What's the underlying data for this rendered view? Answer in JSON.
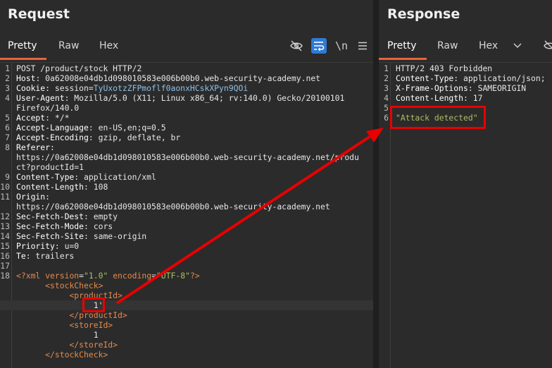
{
  "request": {
    "title": "Request",
    "tabs": [
      "Pretty",
      "Raw",
      "Hex"
    ],
    "active_tab": "Pretty",
    "toolbar": {
      "newline_label": "\\n",
      "menu_icon": "hamburger-icon",
      "hide_icon": "eye-off-icon",
      "wrap_icon": "wrap-lines-icon"
    },
    "lines": [
      {
        "n": "1",
        "parts": [
          [
            "plain",
            "POST /product/stock HTTP/2"
          ]
        ]
      },
      {
        "n": "2",
        "parts": [
          [
            "hname",
            "Host"
          ],
          [
            "plain",
            ": 0a62008e04db1d098010583e006b00b0.web-security-academy.net"
          ]
        ]
      },
      {
        "n": "3",
        "parts": [
          [
            "hname",
            "Cookie"
          ],
          [
            "plain",
            ": session="
          ],
          [
            "cookieval",
            "TyUxotzZFPmoflf0aonxHCskXPyn9QOi"
          ]
        ]
      },
      {
        "n": "4",
        "parts": [
          [
            "hname",
            "User-Agent"
          ],
          [
            "plain",
            ": Mozilla/5.0 (X11; Linux x86_64; rv:140.0) Gecko/20100101"
          ]
        ]
      },
      {
        "n": "",
        "parts": [
          [
            "plain",
            "Firefox/140.0"
          ]
        ]
      },
      {
        "n": "5",
        "parts": [
          [
            "hname",
            "Accept"
          ],
          [
            "plain",
            ": */*"
          ]
        ]
      },
      {
        "n": "6",
        "parts": [
          [
            "hname",
            "Accept-Language"
          ],
          [
            "plain",
            ": en-US,en;q=0.5"
          ]
        ]
      },
      {
        "n": "7",
        "parts": [
          [
            "hname",
            "Accept-Encoding"
          ],
          [
            "plain",
            ": gzip, deflate, br"
          ]
        ]
      },
      {
        "n": "8",
        "parts": [
          [
            "hname",
            "Referer"
          ],
          [
            "plain",
            ":"
          ]
        ]
      },
      {
        "n": "",
        "parts": [
          [
            "plain",
            "https://0a62008e04db1d098010583e006b00b0.web-security-academy.net/produ"
          ]
        ]
      },
      {
        "n": "",
        "parts": [
          [
            "plain",
            "ct?productId=1"
          ]
        ]
      },
      {
        "n": "9",
        "parts": [
          [
            "hname",
            "Content-Type"
          ],
          [
            "plain",
            ": application/xml"
          ]
        ]
      },
      {
        "n": "10",
        "parts": [
          [
            "hname",
            "Content-Length"
          ],
          [
            "plain",
            ": 108"
          ]
        ]
      },
      {
        "n": "11",
        "parts": [
          [
            "hname",
            "Origin"
          ],
          [
            "plain",
            ":"
          ]
        ]
      },
      {
        "n": "",
        "parts": [
          [
            "plain",
            "https://0a62008e04db1d098010583e006b00b0.web-security-academy.net"
          ]
        ]
      },
      {
        "n": "12",
        "parts": [
          [
            "hname",
            "Sec-Fetch-Dest"
          ],
          [
            "plain",
            ": empty"
          ]
        ]
      },
      {
        "n": "13",
        "parts": [
          [
            "hname",
            "Sec-Fetch-Mode"
          ],
          [
            "plain",
            ": cors"
          ]
        ]
      },
      {
        "n": "14",
        "parts": [
          [
            "hname",
            "Sec-Fetch-Site"
          ],
          [
            "plain",
            ": same-origin"
          ]
        ]
      },
      {
        "n": "15",
        "parts": [
          [
            "hname",
            "Priority"
          ],
          [
            "plain",
            ": u=0"
          ]
        ]
      },
      {
        "n": "16",
        "parts": [
          [
            "hname",
            "Te"
          ],
          [
            "plain",
            ": trailers"
          ]
        ]
      },
      {
        "n": "17",
        "parts": []
      },
      {
        "n": "18",
        "parts": [
          [
            "xml-tag",
            "<?xml "
          ],
          [
            "xml-attr",
            "version"
          ],
          [
            "plain",
            "="
          ],
          [
            "xml-str",
            "\"1.0\""
          ],
          [
            "plain",
            " "
          ],
          [
            "xml-attr",
            "encoding"
          ],
          [
            "plain",
            "="
          ],
          [
            "xml-str",
            "\"UTF-8\""
          ],
          [
            "xml-tag",
            "?>"
          ]
        ]
      },
      {
        "n": "",
        "parts": [
          [
            "plain",
            "      "
          ],
          [
            "xml-tag",
            "<stockCheck>"
          ]
        ]
      },
      {
        "n": "",
        "parts": [
          [
            "plain",
            "           "
          ],
          [
            "xml-tag",
            "<productId>"
          ]
        ]
      },
      {
        "n": "",
        "hl": true,
        "parts": [
          [
            "plain",
            "                1'"
          ]
        ]
      },
      {
        "n": "",
        "parts": [
          [
            "plain",
            "           "
          ],
          [
            "xml-tag",
            "</productId>"
          ]
        ]
      },
      {
        "n": "",
        "parts": [
          [
            "plain",
            "           "
          ],
          [
            "xml-tag",
            "<storeId>"
          ]
        ]
      },
      {
        "n": "",
        "parts": [
          [
            "plain",
            "                1"
          ]
        ]
      },
      {
        "n": "",
        "parts": [
          [
            "plain",
            "           "
          ],
          [
            "xml-tag",
            "</storeId>"
          ]
        ]
      },
      {
        "n": "",
        "parts": [
          [
            "plain",
            "      "
          ],
          [
            "xml-tag",
            "</stockCheck>"
          ]
        ]
      }
    ]
  },
  "response": {
    "title": "Response",
    "tabs": [
      "Pretty",
      "Raw",
      "Hex"
    ],
    "active_tab": "Pretty",
    "toolbar": {
      "dropdown_icon": "chevron-down-icon",
      "hide_icon": "eye-off-icon"
    },
    "lines": [
      {
        "n": "1",
        "parts": [
          [
            "plain",
            "HTTP/2 403 Forbidden"
          ]
        ]
      },
      {
        "n": "2",
        "parts": [
          [
            "hname",
            "Content-Type"
          ],
          [
            "plain",
            ": application/json; "
          ]
        ]
      },
      {
        "n": "3",
        "parts": [
          [
            "hname",
            "X-Frame-Options"
          ],
          [
            "plain",
            ": SAMEORIGIN"
          ]
        ]
      },
      {
        "n": "4",
        "parts": [
          [
            "hname",
            "Content-Length"
          ],
          [
            "plain",
            ": 17"
          ]
        ]
      },
      {
        "n": "5",
        "parts": []
      },
      {
        "n": "6",
        "parts": [
          [
            "str-green",
            "\"Attack detected\""
          ]
        ]
      }
    ]
  },
  "annotations": {
    "color": "#e80000"
  }
}
